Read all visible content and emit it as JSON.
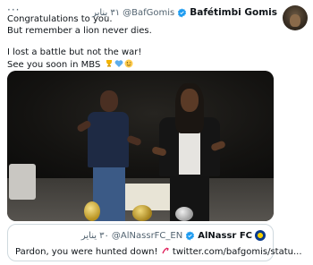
{
  "header": {
    "more": "···",
    "name": "Bafétimbi Gomis",
    "handle": "@BafGomis",
    "time": "٣١ يناير"
  },
  "tweet": {
    "line1": "Congratulations to you.",
    "line2": "But remember a lion never dies.",
    "line3": "I lost a battle but not the war!",
    "line4": "See you soon in MBS"
  },
  "quote": {
    "name": "AlNassr FC",
    "handle": "@AlNassrFC_EN",
    "time": "٣٠ يناير",
    "text": "Pardon, you were hunted down!",
    "link": "twitter.com/bafgomis/statu..."
  },
  "colors": {
    "verified": "#1d9bf0",
    "muted": "#536471",
    "border": "#cfd9de"
  }
}
